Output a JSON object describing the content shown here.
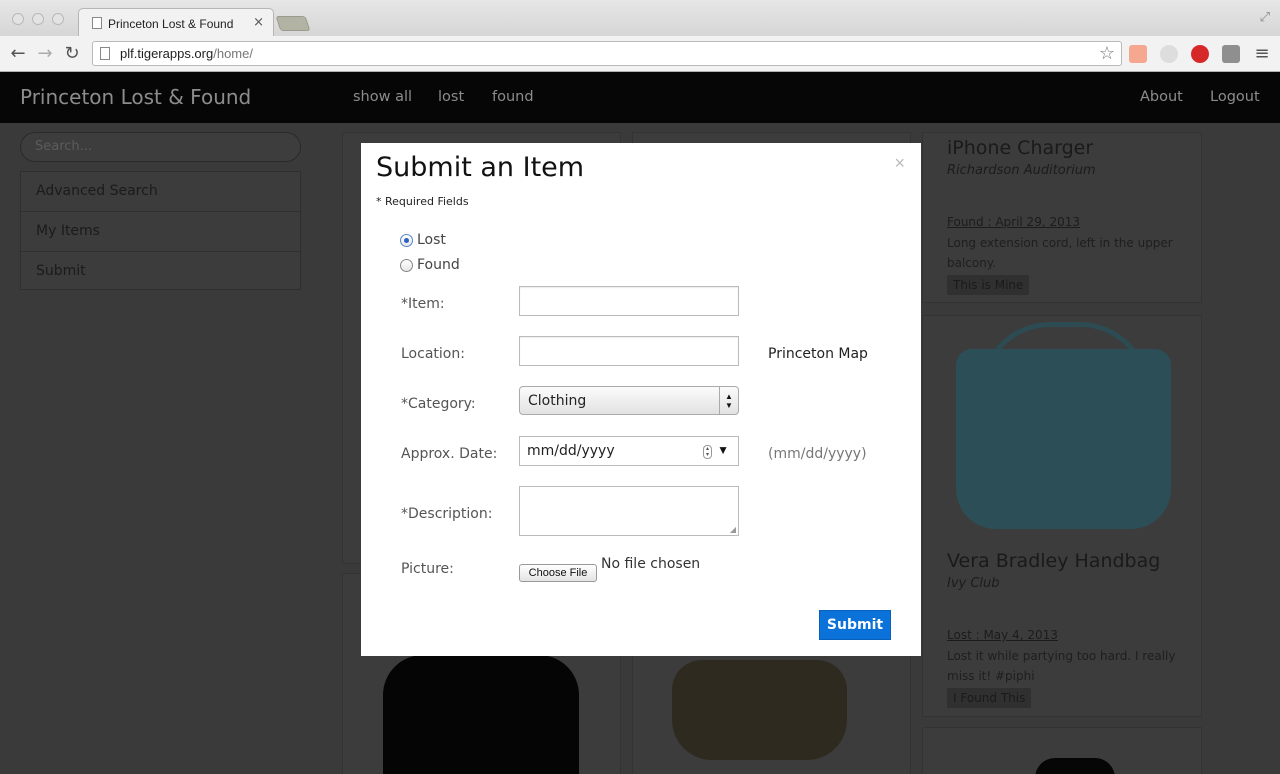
{
  "browser": {
    "tab_title": "Princeton Lost & Found",
    "tab_close": "×",
    "url_host": "plf.tigerapps.org",
    "url_path": "/home/"
  },
  "navbar": {
    "brand": "Princeton Lost & Found",
    "links": [
      "show all",
      "lost",
      "found"
    ],
    "right_links": [
      "About",
      "Logout"
    ]
  },
  "sidebar": {
    "search_placeholder": "Search...",
    "items": [
      "Advanced Search",
      "My Items",
      "Submit"
    ]
  },
  "cards": [
    {
      "title": "iPhone Charger",
      "location": "Richardson Auditorium",
      "date": "Found : April 29, 2013",
      "description": "Long extension cord, left in the upper balcony.",
      "button": "This is Mine"
    },
    {
      "title": "Vera Bradley Handbag",
      "location": "Ivy Club",
      "date": "Lost : May 4, 2013",
      "description": "Lost it while partying too hard. I really miss it! #piphi",
      "button": "I Found This"
    }
  ],
  "modal": {
    "title": "Submit an Item",
    "close": "×",
    "required_note": "* Required Fields",
    "radio_lost": "Lost",
    "radio_found": "Found",
    "selected_radio": "Lost",
    "labels": {
      "item": "*Item:",
      "location": "Location:",
      "category": "*Category:",
      "date": "Approx. Date:",
      "description": "*Description:",
      "picture": "Picture:"
    },
    "map_link": "Princeton Map",
    "category_value": "Clothing",
    "date_placeholder": "mm/dd/yyyy",
    "date_hint": "(mm/dd/yyyy)",
    "file_button": "Choose File",
    "file_status": "No file chosen",
    "submit": "Submit"
  },
  "colors": {
    "accent": "#0a72d9",
    "overlay": "#3a3a3a",
    "navbar": "#060606"
  }
}
